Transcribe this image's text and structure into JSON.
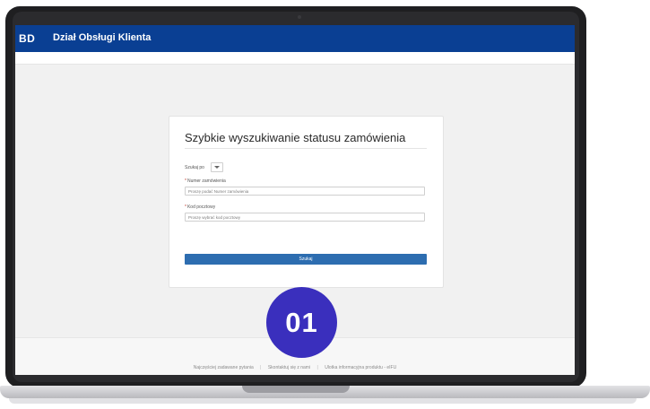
{
  "header": {
    "logo": "BD",
    "title": "Dział Obsługi Klienta"
  },
  "card": {
    "title": "Szybkie wyszukiwanie statusu zamówienia",
    "search_by_label": "Szukaj po",
    "order_number": {
      "required_mark": "*",
      "label": "Numer zamówienia",
      "placeholder": "Proszę podać Numer zamówienia"
    },
    "postal_code": {
      "required_mark": "*",
      "label": "Kod pocztowy",
      "placeholder": "Proszę wybrać kod pocztowy"
    },
    "search_button": "Szukaj"
  },
  "footer": {
    "links": [
      "Najczęściej zadawane pytania",
      "Skontaktuj się z nami",
      "Ulotka informacyjna produktu - eIFU"
    ],
    "separator": "|"
  },
  "step_badge": "01",
  "colors": {
    "header_bg": "#0a3f93",
    "button_bg": "#2d6db0",
    "badge_bg": "#3a2fbd"
  }
}
